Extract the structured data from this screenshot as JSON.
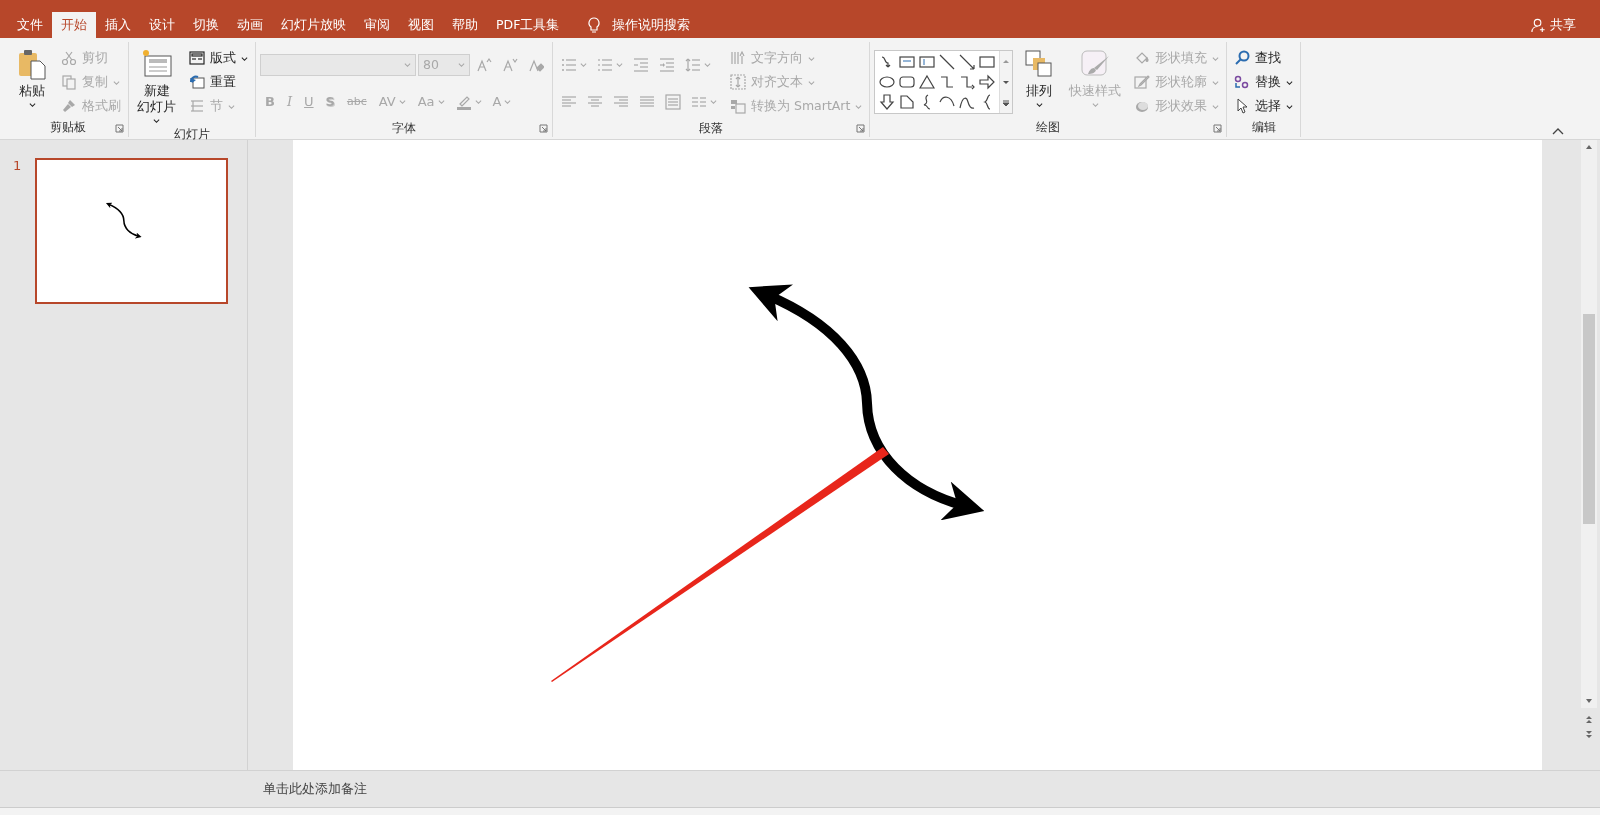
{
  "tabs": [
    {
      "label": "文件",
      "selected": false
    },
    {
      "label": "开始",
      "selected": true
    },
    {
      "label": "插入",
      "selected": false
    },
    {
      "label": "设计",
      "selected": false
    },
    {
      "label": "切换",
      "selected": false
    },
    {
      "label": "动画",
      "selected": false
    },
    {
      "label": "幻灯片放映",
      "selected": false
    },
    {
      "label": "审阅",
      "selected": false
    },
    {
      "label": "视图",
      "selected": false
    },
    {
      "label": "帮助",
      "selected": false
    },
    {
      "label": "PDF工具集",
      "selected": false
    }
  ],
  "tell_me": {
    "placeholder": "操作说明搜索"
  },
  "share": {
    "label": "共享"
  },
  "ribbon": {
    "groups": [
      {
        "label": "剪贴板",
        "launcher": true,
        "items": [
          {
            "kind": "large",
            "lines": [
              "粘贴"
            ],
            "dropdown": true,
            "disabled": false
          },
          {
            "kind": "column",
            "items": [
              {
                "kind": "small",
                "label": "剪切",
                "dropdown": false,
                "disabled": true
              },
              {
                "kind": "small",
                "label": "复制",
                "dropdown": true,
                "disabled": true
              },
              {
                "kind": "small",
                "label": "格式刷",
                "dropdown": false,
                "disabled": true
              }
            ]
          }
        ]
      },
      {
        "label": "幻灯片",
        "launcher": false,
        "items": [
          {
            "kind": "large",
            "lines": [
              "新建",
              "幻灯片"
            ],
            "dropdown": true,
            "disabled": false
          },
          {
            "kind": "column",
            "items": [
              {
                "kind": "small",
                "label": "版式",
                "dropdown": true,
                "disabled": false
              },
              {
                "kind": "small",
                "label": "重置",
                "dropdown": false,
                "disabled": false
              },
              {
                "kind": "small",
                "label": "节",
                "dropdown": true,
                "disabled": true
              }
            ]
          }
        ]
      },
      {
        "label": "字体",
        "launcher": true,
        "items": [
          {
            "kind": "column",
            "items": [
              {
                "kind": "row",
                "items": [
                  {
                    "kind": "combo",
                    "wide": true,
                    "disabled": true
                  },
                  {
                    "kind": "combo",
                    "value": "80",
                    "wide": false,
                    "disabled": true
                  },
                  {
                    "kind": "icon",
                    "dropdown": false,
                    "disabled": true
                  },
                  {
                    "kind": "icon",
                    "dropdown": false,
                    "disabled": true
                  },
                  {
                    "kind": "icon",
                    "dropdown": false,
                    "disabled": true
                  }
                ]
              },
              {
                "kind": "row",
                "items": [
                  {
                    "kind": "bold",
                    "label": "B",
                    "dropdown": false,
                    "disabled": true
                  },
                  {
                    "kind": "italic",
                    "label": "I",
                    "dropdown": false,
                    "disabled": true
                  },
                  {
                    "kind": "underline",
                    "label": "U",
                    "dropdown": false,
                    "disabled": true
                  },
                  {
                    "kind": "shadow",
                    "label": "S",
                    "dropdown": false,
                    "disabled": true
                  },
                  {
                    "kind": "strike",
                    "label": "abc",
                    "dropdown": false,
                    "disabled": true
                  },
                  {
                    "kind": "glyph",
                    "label": "AV",
                    "dropdown": true,
                    "disabled": true
                  },
                  {
                    "kind": "glyph",
                    "label": "Aa",
                    "dropdown": true,
                    "disabled": true
                  },
                  {
                    "kind": "icon",
                    "dropdown": true,
                    "disabled": true
                  },
                  {
                    "kind": "glyph",
                    "label": "A",
                    "dropdown": true,
                    "disabled": true
                  }
                ]
              }
            ]
          }
        ]
      },
      {
        "label": "段落",
        "launcher": true,
        "items": [
          {
            "kind": "column",
            "items": [
              {
                "kind": "row",
                "items": [
                  {
                    "kind": "icon",
                    "dropdown": true,
                    "disabled": true
                  },
                  {
                    "kind": "icon",
                    "dropdown": true,
                    "disabled": true
                  },
                  {
                    "kind": "icon",
                    "dropdown": false,
                    "disabled": true
                  },
                  {
                    "kind": "icon",
                    "dropdown": false,
                    "disabled": true
                  },
                  {
                    "kind": "icon",
                    "dropdown": true,
                    "disabled": true
                  }
                ]
              },
              {
                "kind": "row",
                "items": [
                  {
                    "kind": "icon",
                    "dropdown": false,
                    "disabled": true
                  },
                  {
                    "kind": "icon",
                    "dropdown": false,
                    "disabled": true
                  },
                  {
                    "kind": "icon",
                    "dropdown": false,
                    "disabled": true
                  },
                  {
                    "kind": "icon",
                    "dropdown": false,
                    "disabled": true
                  },
                  {
                    "kind": "icon",
                    "dropdown": false,
                    "disabled": true
                  },
                  {
                    "kind": "icon",
                    "dropdown": true,
                    "disabled": true
                  }
                ]
              }
            ]
          },
          {
            "kind": "column",
            "items": [
              {
                "kind": "small",
                "label": "文字方向",
                "dropdown": true,
                "disabled": true
              },
              {
                "kind": "small",
                "label": "对齐文本",
                "dropdown": true,
                "disabled": true
              },
              {
                "kind": "small",
                "label": "转换为 SmartArt",
                "dropdown": true,
                "disabled": true
              }
            ]
          }
        ]
      },
      {
        "label": "绘图",
        "launcher": true,
        "items": [
          {
            "kind": "gallery"
          },
          {
            "kind": "large",
            "lines": [
              "排列"
            ],
            "dropdown": true,
            "disabled": false
          },
          {
            "kind": "large",
            "lines": [
              "快速样式"
            ],
            "dropdown": true,
            "disabled": true
          },
          {
            "kind": "column",
            "items": [
              {
                "kind": "small",
                "label": "形状填充",
                "dropdown": true,
                "disabled": true
              },
              {
                "kind": "small",
                "label": "形状轮廓",
                "dropdown": true,
                "disabled": true
              },
              {
                "kind": "small",
                "label": "形状效果",
                "dropdown": true,
                "disabled": true
              }
            ]
          }
        ]
      },
      {
        "label": "编辑",
        "launcher": false,
        "items": [
          {
            "kind": "column",
            "items": [
              {
                "kind": "small",
                "label": "查找",
                "dropdown": false,
                "disabled": false
              },
              {
                "kind": "small",
                "label": "替换",
                "dropdown": true,
                "disabled": false
              },
              {
                "kind": "small",
                "label": "选择",
                "dropdown": true,
                "disabled": false
              }
            ]
          }
        ]
      }
    ]
  },
  "slides": [
    {
      "number": "1",
      "selected": true
    }
  ],
  "notes": {
    "placeholder": "单击此处添加备注"
  }
}
